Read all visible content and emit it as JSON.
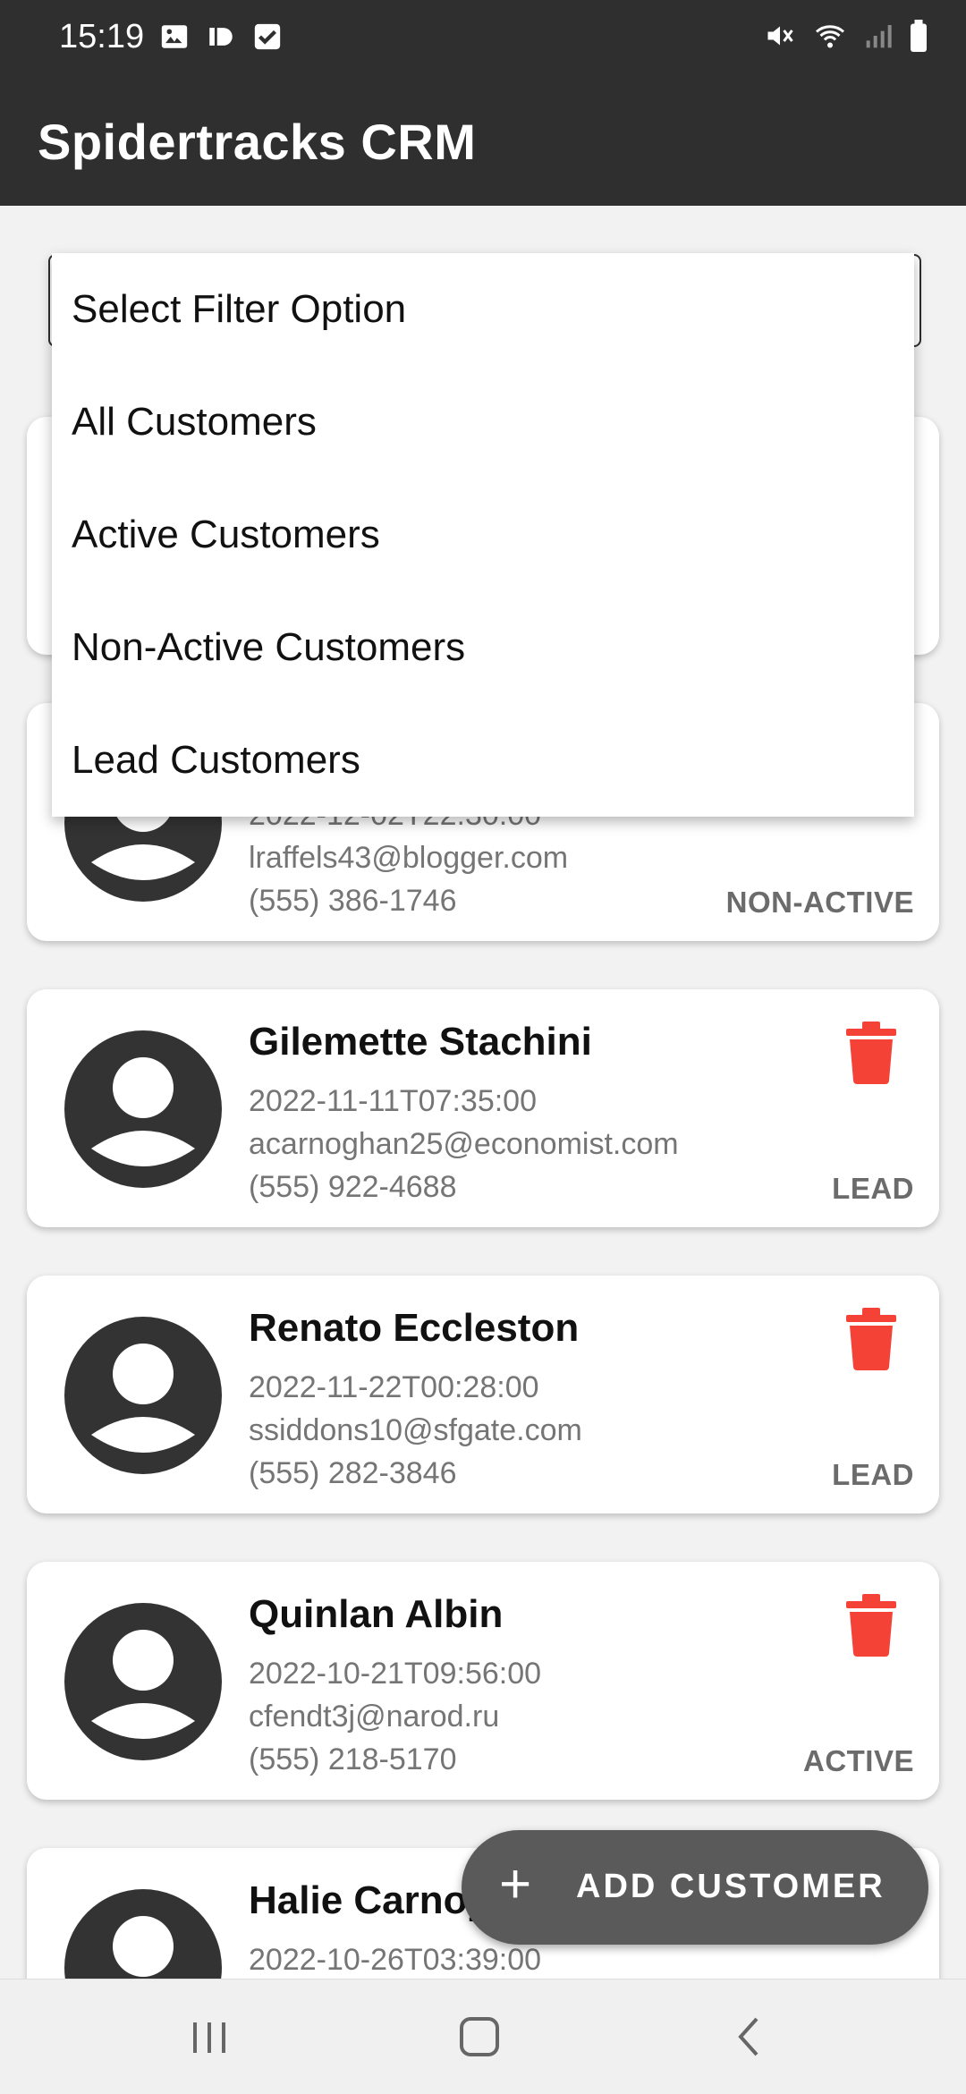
{
  "status_bar": {
    "time": "15:19",
    "left_icons": [
      "gallery-icon",
      "app-notification-icon",
      "checkbox-notification-icon"
    ],
    "right_icons": [
      "mute-icon",
      "wifi-icon",
      "signal-icon",
      "battery-icon"
    ]
  },
  "app_bar": {
    "title": "Spidertracks CRM"
  },
  "filter": {
    "options": [
      "Select Filter Option",
      "All Customers",
      "Active Customers",
      "Non-Active Customers",
      "Lead Customers"
    ]
  },
  "customers": [
    {
      "name": "",
      "date": "",
      "email": "",
      "phone": "",
      "status": ""
    },
    {
      "name": "",
      "date": "2022-12-02T22:30:00",
      "email": "lraffels43@blogger.com",
      "phone": "(555) 386-1746",
      "status": "NON-ACTIVE"
    },
    {
      "name": "Gilemette Stachini",
      "date": "2022-11-11T07:35:00",
      "email": "acarnoghan25@economist.com",
      "phone": "(555) 922-4688",
      "status": "LEAD"
    },
    {
      "name": "Renato Eccleston",
      "date": "2022-11-22T00:28:00",
      "email": "ssiddons10@sfgate.com",
      "phone": "(555) 282-3846",
      "status": "LEAD"
    },
    {
      "name": "Quinlan Albin",
      "date": "2022-10-21T09:56:00",
      "email": "cfendt3j@narod.ru",
      "phone": "(555) 218-5170",
      "status": "ACTIVE"
    },
    {
      "name": "Halie Carnoy",
      "date": "2022-10-26T03:39:00",
      "email": "",
      "phone": "",
      "status": ""
    }
  ],
  "fab": {
    "icon": "plus-icon",
    "label": "ADD CUSTOMER"
  },
  "colors": {
    "app_bar": "#2f2f2f",
    "delete": "#f44336",
    "fab": "#5a5a5a",
    "background": "#f2f2f2"
  },
  "nav": {
    "icons": [
      "recents-icon",
      "home-icon",
      "back-icon"
    ]
  }
}
